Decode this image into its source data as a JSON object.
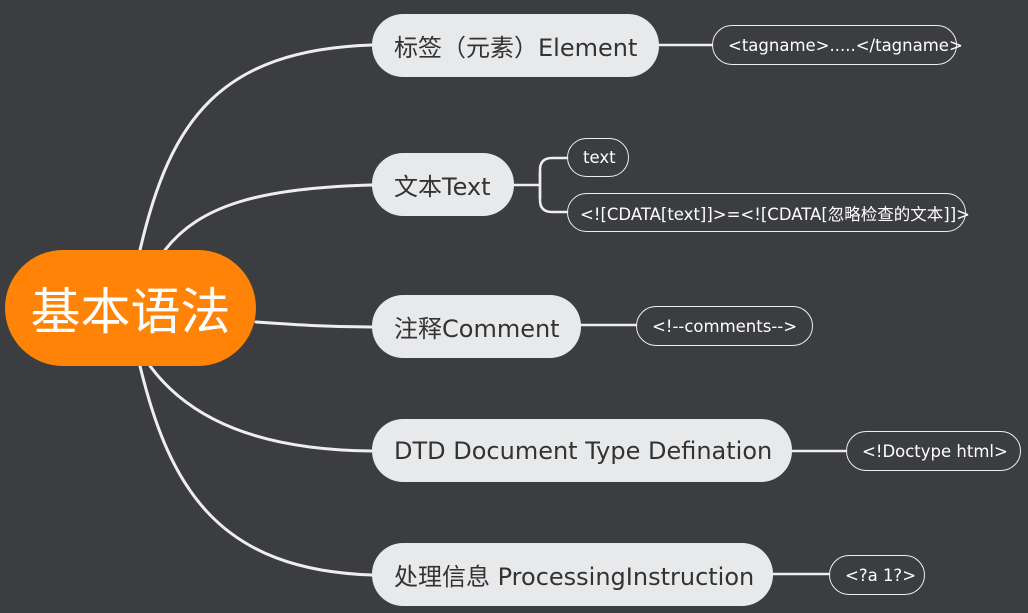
{
  "root": {
    "label": "基本语法"
  },
  "branches": [
    {
      "label": "标签（元素）Element",
      "leaves": [
        {
          "label": "<tagname>.....</tagname>"
        }
      ]
    },
    {
      "label": "文本Text",
      "leaves": [
        {
          "label": "text"
        },
        {
          "label": "<![CDATA[text]]>=<![CDATA[忽略检查的文本]]>"
        }
      ]
    },
    {
      "label": "注释Comment",
      "leaves": [
        {
          "label": "<!--comments-->"
        }
      ]
    },
    {
      "label": "DTD Document Type Defination",
      "leaves": [
        {
          "label": "<!Doctype html>"
        }
      ]
    },
    {
      "label": "处理信息 ProcessingInstruction",
      "leaves": [
        {
          "label": "<?a 1?>"
        }
      ]
    }
  ],
  "colors": {
    "background": "#3b3d41",
    "root_fill": "#ff8306",
    "branch_fill": "#e8e9eb",
    "line": "#eeeeee"
  }
}
